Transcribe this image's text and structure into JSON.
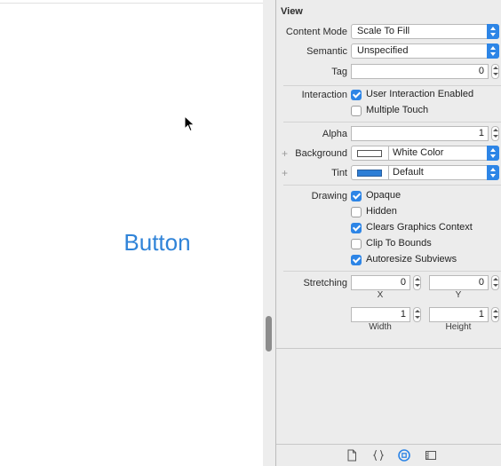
{
  "canvas": {
    "button_label": "Button"
  },
  "inspector": {
    "section_title": "View",
    "content_mode": {
      "label": "Content Mode",
      "value": "Scale To Fill"
    },
    "semantic": {
      "label": "Semantic",
      "value": "Unspecified"
    },
    "tag": {
      "label": "Tag",
      "value": "0"
    },
    "interaction": {
      "label": "Interaction",
      "user_interaction": {
        "label": "User Interaction Enabled",
        "checked": true
      },
      "multiple_touch": {
        "label": "Multiple Touch",
        "checked": false
      }
    },
    "alpha": {
      "label": "Alpha",
      "value": "1"
    },
    "background": {
      "label": "Background",
      "value": "White Color",
      "swatch": "#ffffff"
    },
    "tint": {
      "label": "Tint",
      "value": "Default",
      "swatch": "#2d7ed6"
    },
    "drawing": {
      "label": "Drawing",
      "opaque": {
        "label": "Opaque",
        "checked": true
      },
      "hidden": {
        "label": "Hidden",
        "checked": false
      },
      "clears": {
        "label": "Clears Graphics Context",
        "checked": true
      },
      "clip": {
        "label": "Clip To Bounds",
        "checked": false
      },
      "autoresize": {
        "label": "Autoresize Subviews",
        "checked": true
      }
    },
    "stretching": {
      "label": "Stretching",
      "x": {
        "value": "0",
        "caption": "X"
      },
      "y": {
        "value": "0",
        "caption": "Y"
      },
      "width": {
        "value": "1",
        "caption": "Width"
      },
      "height": {
        "value": "1",
        "caption": "Height"
      }
    },
    "plus_glyph": "+"
  },
  "bottom_tabs": [
    "file-icon",
    "braces-icon",
    "attributes-icon",
    "size-ruler-icon"
  ],
  "colors": {
    "accent": "#2d85e6",
    "button_text": "#2f83d8"
  }
}
